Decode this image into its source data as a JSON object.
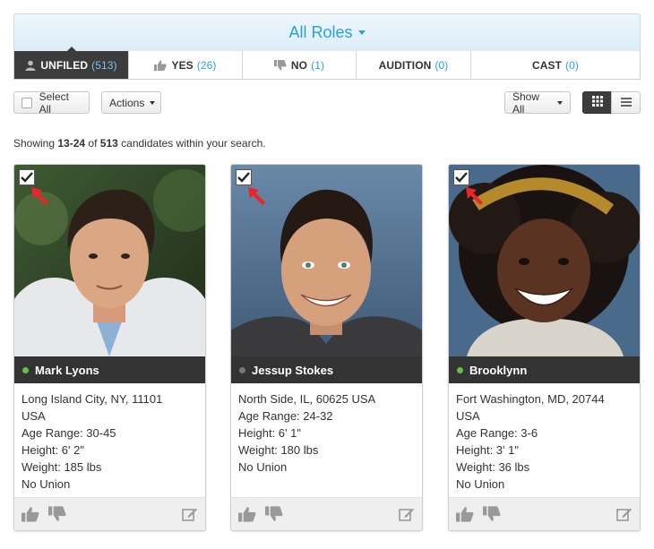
{
  "role_selector": {
    "label": "All Roles"
  },
  "tabs": [
    {
      "label": "UNFILED",
      "count": "(513)",
      "active": true,
      "icon": "user-icon"
    },
    {
      "label": "YES",
      "count": "(26)",
      "active": false,
      "icon": "thumbs-up-icon"
    },
    {
      "label": "NO",
      "count": "(1)",
      "active": false,
      "icon": "thumbs-down-icon"
    },
    {
      "label": "AUDITION",
      "count": "(0)",
      "active": false,
      "icon": ""
    },
    {
      "label": "CAST",
      "count": "(0)",
      "active": false,
      "icon": ""
    }
  ],
  "toolbar": {
    "select_all_label": "Select All",
    "actions_label": "Actions",
    "show_all_label": "Show All",
    "grid_view_icon": "grid-view-icon",
    "list_view_icon": "list-view-icon"
  },
  "results": {
    "prefix": "Showing",
    "range": "13-24",
    "of_text": "of",
    "total": "513",
    "suffix": "candidates within your search."
  },
  "candidates": [
    {
      "name": "Mark Lyons",
      "status_color": "#5cc63a",
      "checked": true,
      "details": [
        "Long Island City, NY, 11101",
        "USA",
        "Age Range: 30-45",
        "Height: 6' 2\"",
        "Weight: 185 lbs",
        "No Union"
      ]
    },
    {
      "name": "Jessup Stokes",
      "status_color": "#777777",
      "checked": true,
      "details": [
        "North Side, IL, 60625 USA",
        "Age Range: 24-32",
        "Height: 6' 1\"",
        "Weight: 180 lbs",
        "No Union"
      ]
    },
    {
      "name": "Brooklynn",
      "status_color": "#5cc63a",
      "checked": true,
      "details": [
        "Fort Washington, MD, 20744",
        "USA",
        "Age Range: 3-6",
        "Height: 3' 1\"",
        "Weight: 36 lbs",
        "No Union"
      ]
    }
  ],
  "colors": {
    "accent": "#2aa1dc",
    "dark_bar": "#333333",
    "annotation_arrow": "#e8262b"
  }
}
